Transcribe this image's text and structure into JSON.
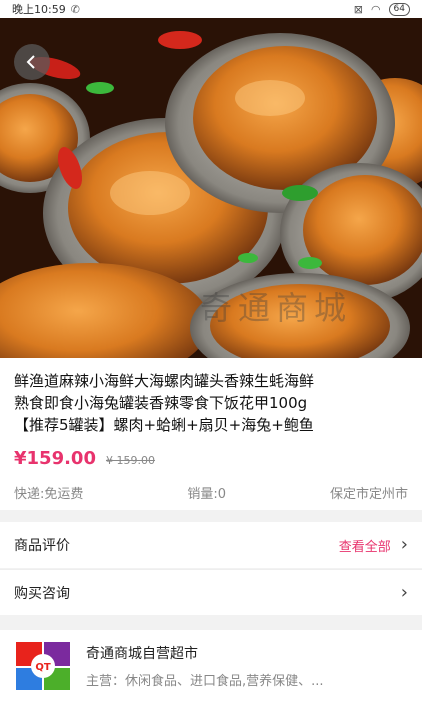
{
  "status_bar": {
    "time": "晚上10:59",
    "battery": "64"
  },
  "hero": {
    "watermark": "奇通商城"
  },
  "product": {
    "title_line1": "鲜渔道麻辣小海鲜大海螺肉罐头香辣生蚝海鲜",
    "title_line2": "熟食即食小海兔罐装香辣零食下饭花甲100g",
    "title_line3": "【推荐5罐装】螺肉+蛤蜊+扇贝+海兔+鲍鱼",
    "price": "¥159.00",
    "original_price": "¥ 159.00",
    "shipping": "快递:免运费",
    "sales": "销量:0",
    "location": "保定市定州市"
  },
  "reviews": {
    "label": "商品评价",
    "link": "查看全部"
  },
  "consult": {
    "label": "购买咨询"
  },
  "store": {
    "logo_text": "QT",
    "name": "奇通商城自营超市",
    "main_business": "主营：休闲食品、进口食品,营养保健、..."
  },
  "colors": {
    "accent": "#e8336d",
    "background": "#f2f2f2"
  },
  "icons": [
    "back-arrow-icon",
    "chevron-right-icon",
    "wifi-icon",
    "battery-icon"
  ]
}
